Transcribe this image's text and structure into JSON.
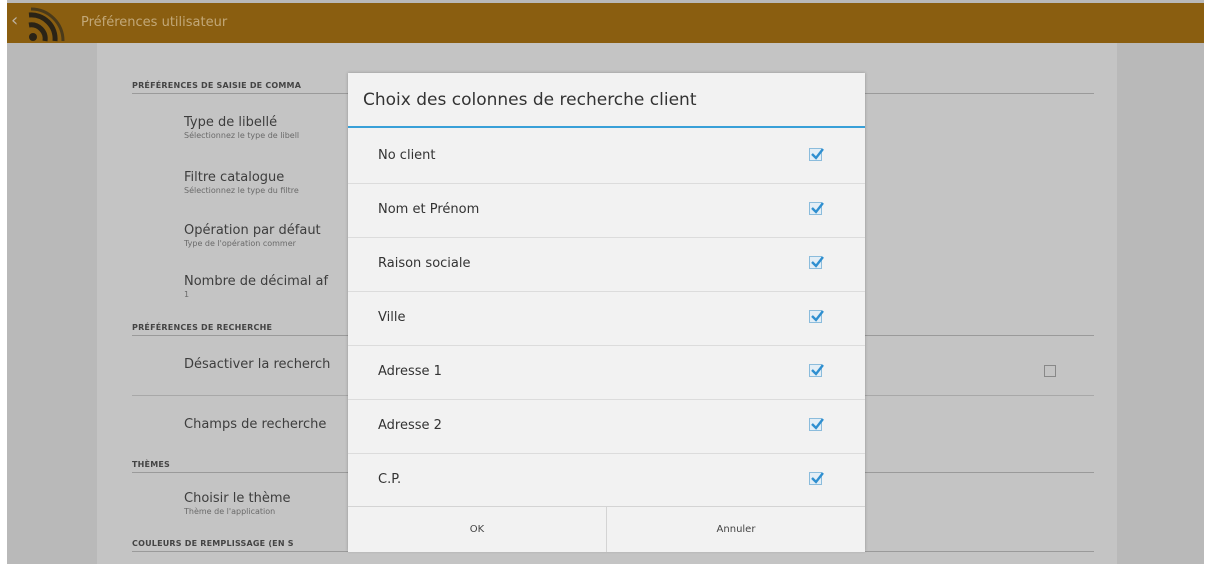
{
  "actionbar": {
    "title": "Préférences utilisateur",
    "back_icon": "chevron-left-icon",
    "logo_icon": "rss-logo-icon"
  },
  "background": {
    "categories": {
      "saisie": "PRÉFÉRENCES DE SAISIE DE COMMA",
      "recherche": "PRÉFÉRENCES DE RECHERCHE",
      "themes": "THÈMES",
      "couleurs": "COULEURS DE REMPLISSAGE (EN S"
    },
    "prefs": {
      "type_libelle": {
        "title": "Type de libellé",
        "summary": "Sélectionnez le type de libell"
      },
      "filtre_catalogue": {
        "title": "Filtre catalogue",
        "summary": "Sélectionnez le type du filtre"
      },
      "operation_defaut": {
        "title": "Opération par défaut",
        "summary": "Type de l'opération commer"
      },
      "nombre_decimal": {
        "title": "Nombre de décimal af",
        "summary": "1"
      },
      "desactiver_recherche": {
        "title": "Désactiver la recherch"
      },
      "champs_recherche": {
        "title": "Champs de recherche"
      },
      "choisir_theme": {
        "title": "Choisir le thème",
        "summary": "Thème de l'application"
      }
    }
  },
  "dialog": {
    "title": "Choix des colonnes de recherche client",
    "items": [
      {
        "label": "No client",
        "checked": true
      },
      {
        "label": "Nom et Prénom",
        "checked": true
      },
      {
        "label": "Raison sociale",
        "checked": true
      },
      {
        "label": "Ville",
        "checked": true
      },
      {
        "label": "Adresse 1",
        "checked": true
      },
      {
        "label": "Adresse 2",
        "checked": true
      },
      {
        "label": "C.P.",
        "checked": true
      }
    ],
    "ok_label": "OK",
    "cancel_label": "Annuler"
  },
  "colors": {
    "actionbar": "#8a5e10",
    "accent": "#39a0d8",
    "check": "#2f8fd0"
  }
}
